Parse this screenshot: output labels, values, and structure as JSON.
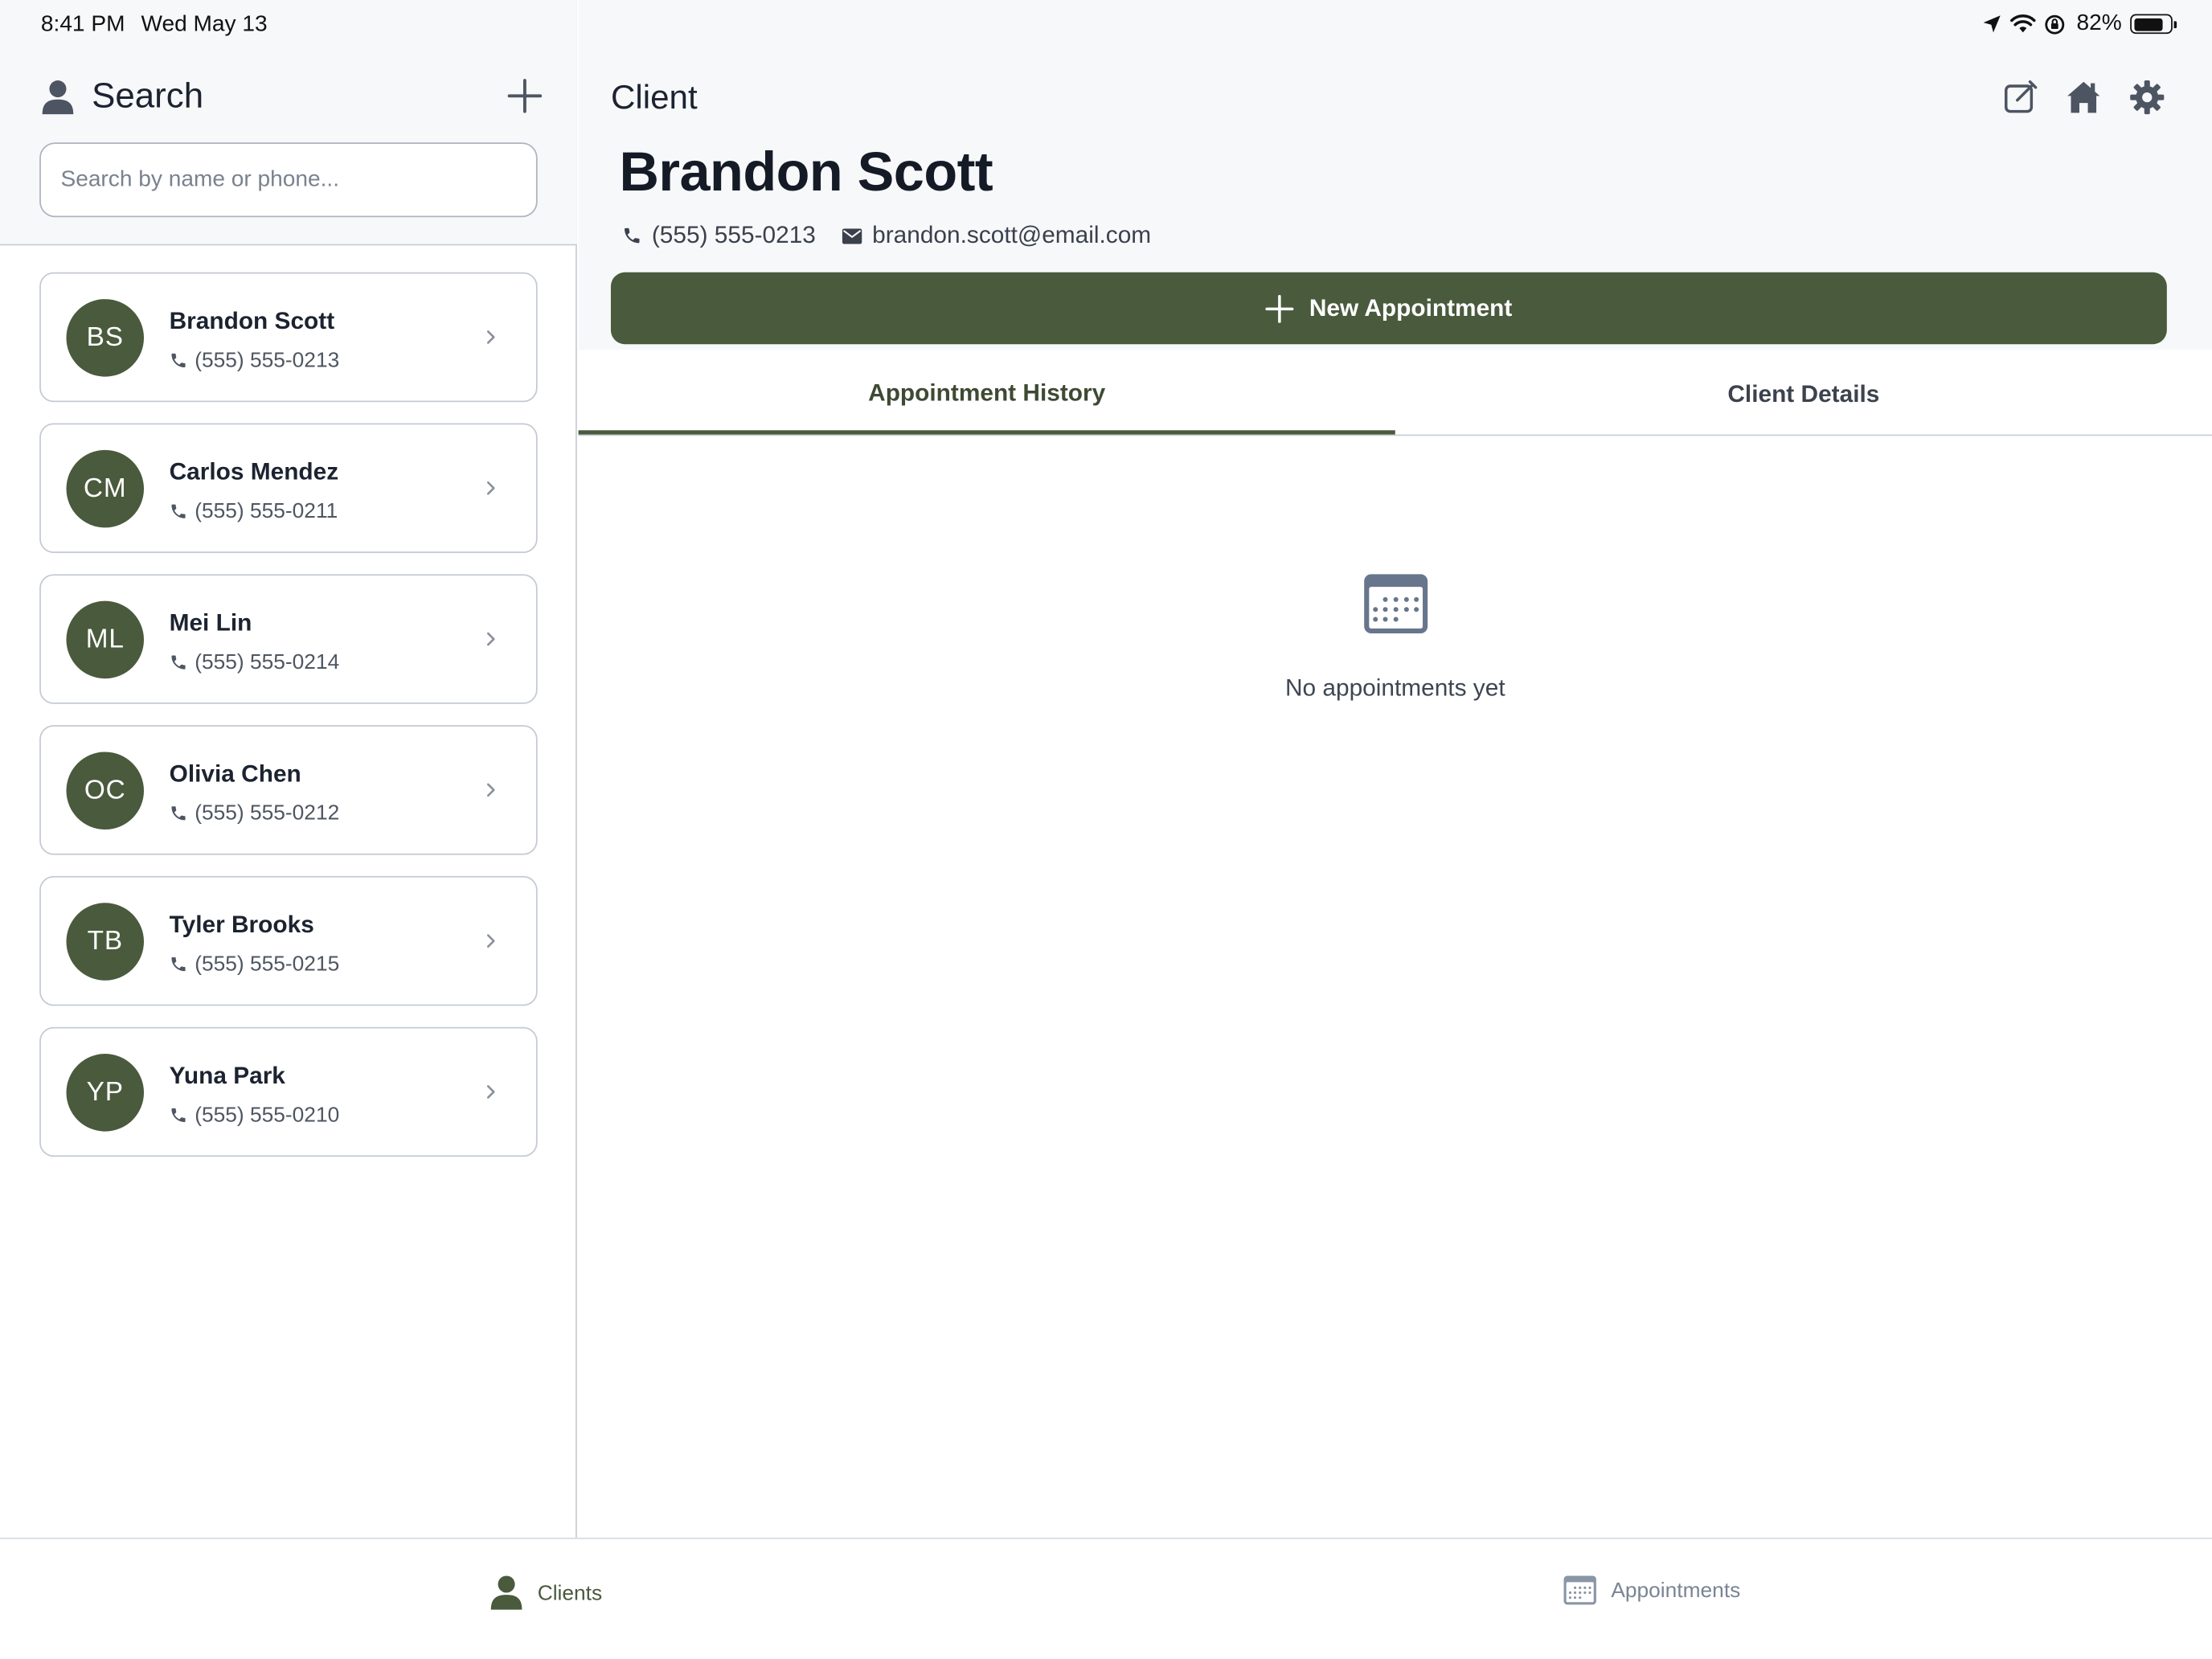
{
  "status_bar": {
    "time": "8:41 PM",
    "date": "Wed May 13",
    "battery": "82%"
  },
  "sidebar": {
    "title": "Search",
    "search_placeholder": "Search by name or phone...",
    "clients": [
      {
        "initials": "BS",
        "name": "Brandon Scott",
        "phone": "(555) 555-0213"
      },
      {
        "initials": "CM",
        "name": "Carlos Mendez",
        "phone": "(555) 555-0211"
      },
      {
        "initials": "ML",
        "name": "Mei Lin",
        "phone": "(555) 555-0214"
      },
      {
        "initials": "OC",
        "name": "Olivia Chen",
        "phone": "(555) 555-0212"
      },
      {
        "initials": "TB",
        "name": "Tyler Brooks",
        "phone": "(555) 555-0215"
      },
      {
        "initials": "YP",
        "name": "Yuna Park",
        "phone": "(555) 555-0210"
      }
    ]
  },
  "main": {
    "title": "Client",
    "client_name": "Brandon Scott",
    "phone": "(555) 555-0213",
    "email": "brandon.scott@email.com",
    "new_appointment_label": "New Appointment",
    "tabs": [
      {
        "label": "Appointment History",
        "active": true
      },
      {
        "label": "Client Details",
        "active": false
      }
    ],
    "empty_text": "No appointments yet"
  },
  "tab_bar": {
    "items": [
      {
        "label": "Clients",
        "active": true
      },
      {
        "label": "Appointments",
        "active": false
      }
    ]
  },
  "colors": {
    "accent": "#4a5a3d",
    "panel_bg": "#f7f8fa",
    "border": "#c9ced6",
    "muted_text": "#7a8493"
  }
}
